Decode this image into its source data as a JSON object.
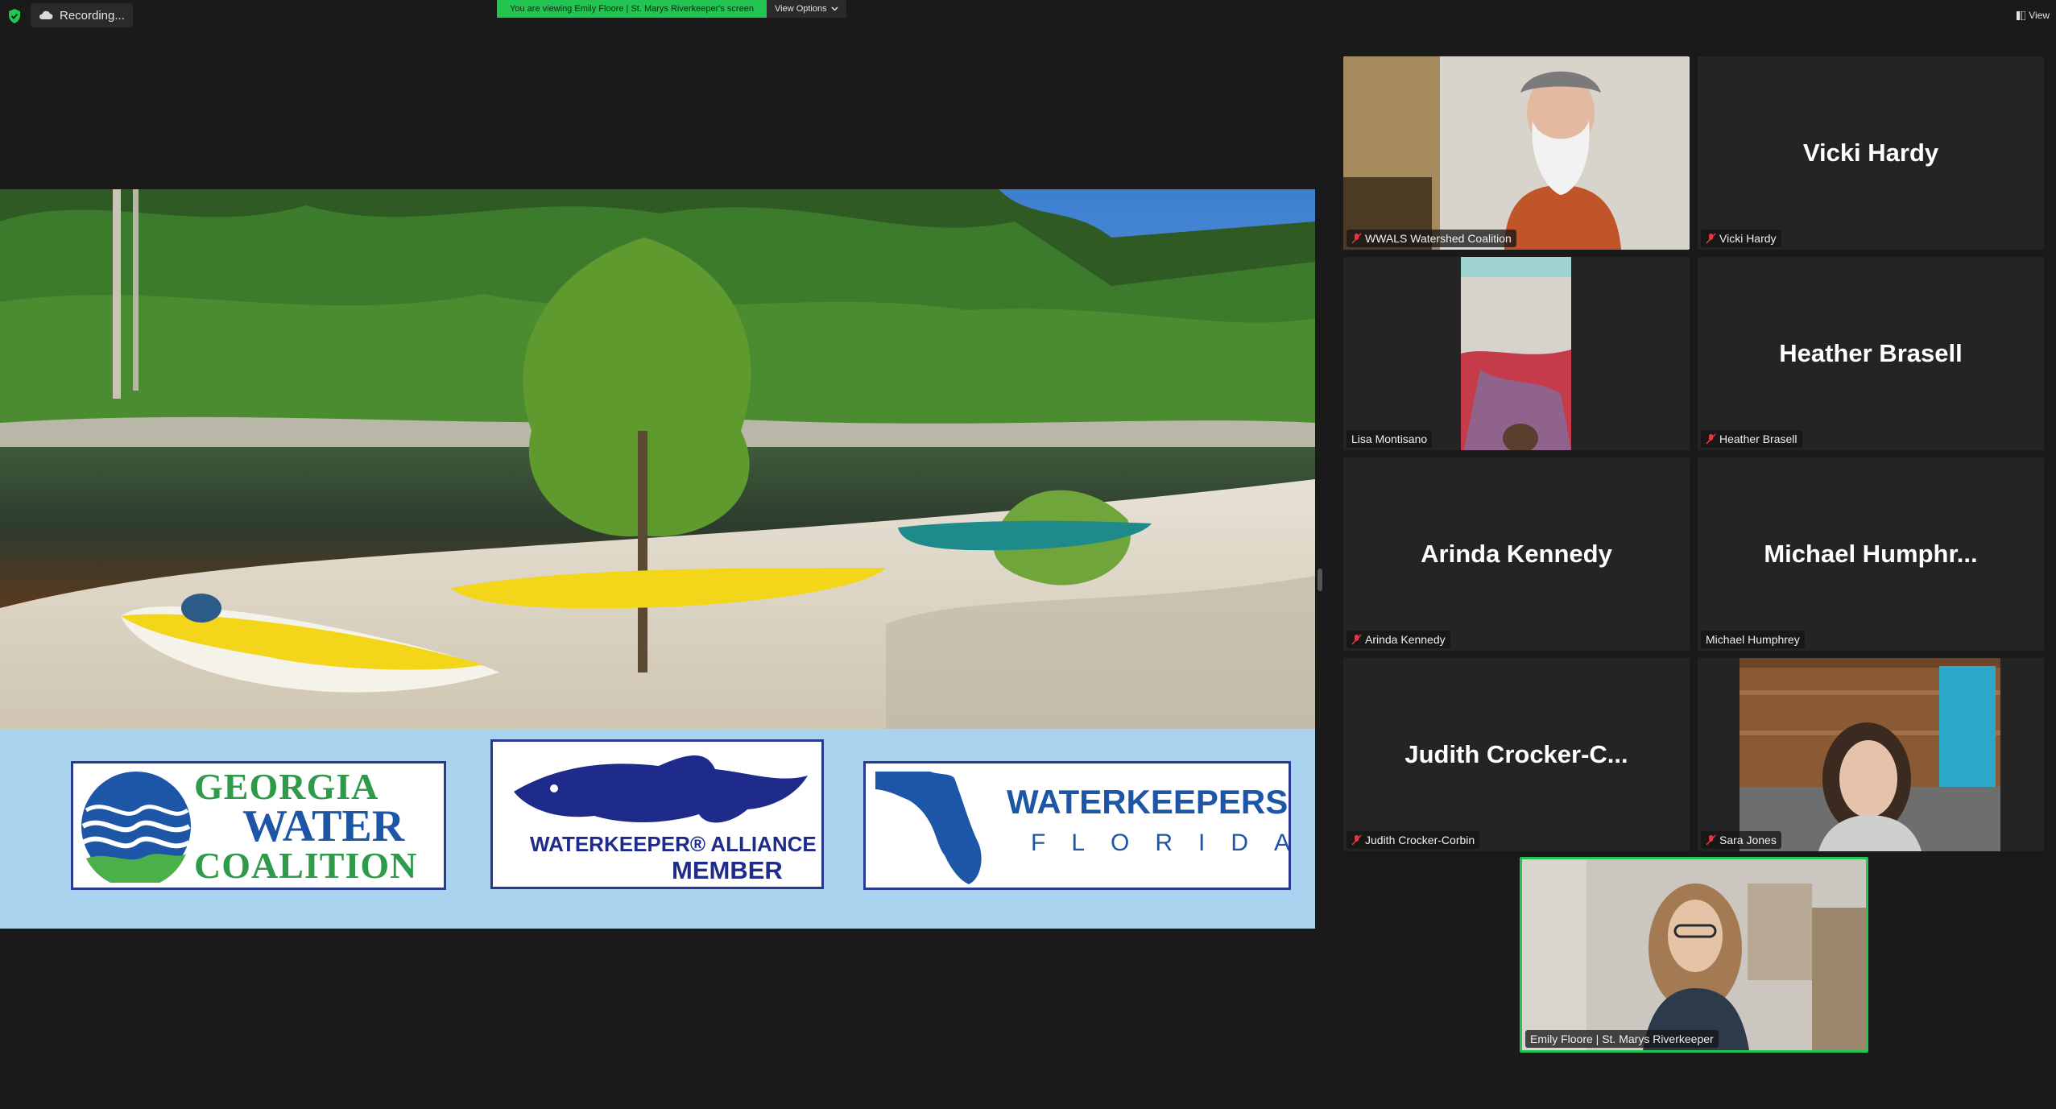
{
  "topbar": {
    "recording_label": "Recording...",
    "viewing_banner": "You are viewing Emily Floore | St. Marys Riverkeeper's screen",
    "view_options_label": "View Options",
    "view_label": "View"
  },
  "shared_screen": {
    "logos": {
      "gwc_line1": "GEORGIA",
      "gwc_line2": "WATER",
      "gwc_line3": "COALITION",
      "wka_line1": "WATERKEEPER® ALLIANCE",
      "wka_line2": "MEMBER",
      "wkf_line1": "WATERKEEPERS®",
      "wkf_line2": "FLORIDA"
    }
  },
  "participants": [
    {
      "tile_text": "",
      "label": "WWALS Watershed Coalition",
      "muted": true
    },
    {
      "tile_text": "Vicki Hardy",
      "label": "Vicki Hardy",
      "muted": true
    },
    {
      "tile_text": "",
      "label": "Lisa Montisano",
      "muted": false
    },
    {
      "tile_text": "Heather Brasell",
      "label": "Heather Brasell",
      "muted": true
    },
    {
      "tile_text": "Arinda Kennedy",
      "label": "Arinda Kennedy",
      "muted": true
    },
    {
      "tile_text": "Michael Humphr...",
      "label": "Michael Humphrey",
      "muted": false
    },
    {
      "tile_text": "Judith Crocker-C...",
      "label": "Judith Crocker-Corbin",
      "muted": true
    },
    {
      "tile_text": "",
      "label": "Sara Jones",
      "muted": true
    },
    {
      "tile_text": "",
      "label": "Emily Floore | St. Marys Riverkeeper",
      "muted": false,
      "active_speaker": true
    }
  ],
  "colors": {
    "background": "#1a1a1a",
    "tile": "#242424",
    "accent_green": "#23c552",
    "muted_red": "#e0393e",
    "logo_band": "#a9d3ee",
    "brand_blue": "#1d56a6"
  }
}
